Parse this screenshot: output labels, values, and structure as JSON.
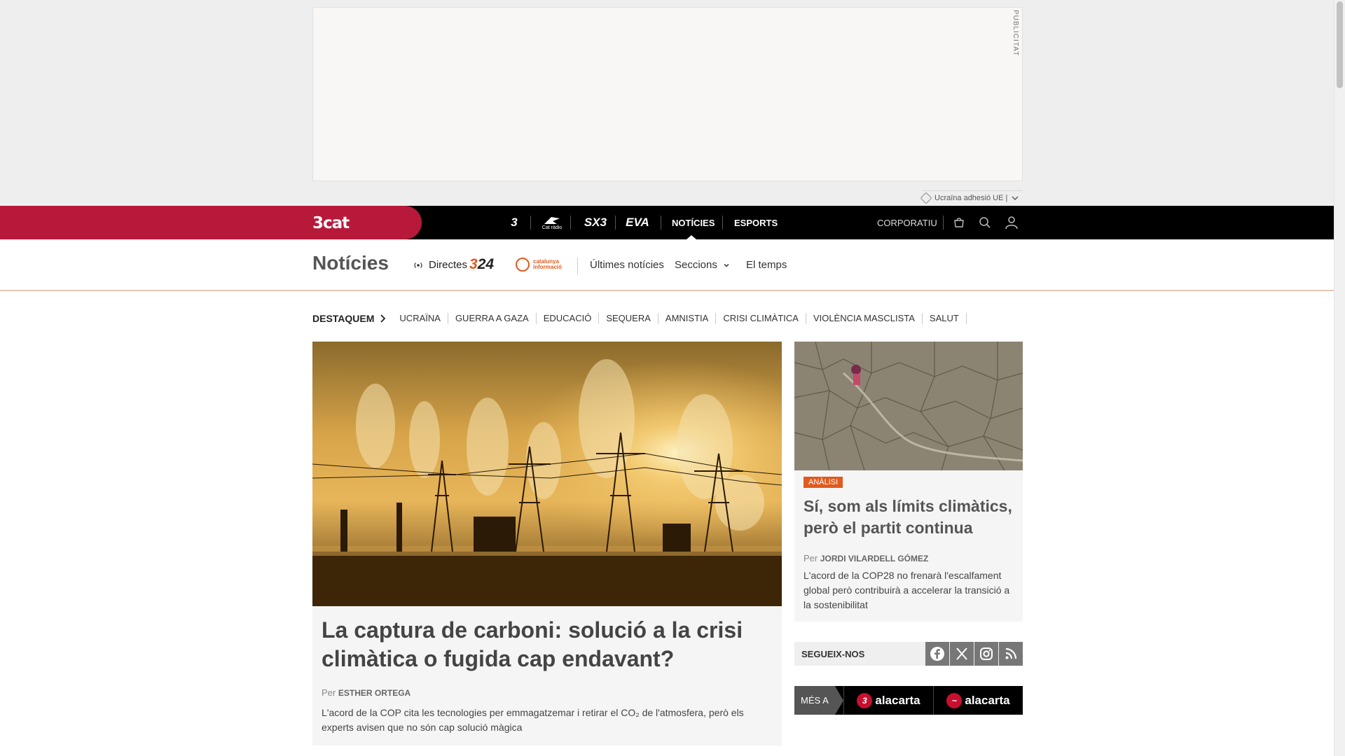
{
  "ad": {
    "label": "PUBLICITAT",
    "tag_text": "Ucraïna adhesió UE |"
  },
  "topnav": {
    "logo": "3cat",
    "channels": [
      "3",
      "Cat ràdio",
      "SX3",
      "EVA"
    ],
    "links": [
      "NOTÍCIES",
      "ESPORTS"
    ],
    "corporate": "CORPORATIU"
  },
  "section": {
    "title": "Notícies",
    "directes": "Directes",
    "logo_324": "324",
    "catinfo_text": "catalunya informació",
    "links": [
      "Últimes notícies",
      "Seccions",
      "El temps"
    ]
  },
  "topics": {
    "label": "DESTAQUEM",
    "items": [
      "UCRAÏNA",
      "GUERRA A GAZA",
      "EDUCACIÓ",
      "SEQUERA",
      "AMNISTIA",
      "CRISI CLIMÀTICA",
      "VIOLÈNCIA MASCLISTA",
      "SALUT"
    ]
  },
  "main_article": {
    "title": "La captura de carboni: solució a la crisi climàtica o fugida cap endavant?",
    "by": "Per",
    "author": "ESTHER ORTEGA",
    "description": "L'acord de la COP cita les tecnologies per emmagatzemar i retirar el CO₂ de l'atmosfera, però els experts avisen que no són cap solució màgica"
  },
  "side_article": {
    "badge": "ANÀLISI",
    "title": "Sí, som als límits climàtics, però el partit continua",
    "by": "Per",
    "author": "JORDI VILARDELL GÓMEZ",
    "description": "L'acord de la COP28 no frenarà l'escalfament global però contribuirà a accelerar la transició a la sostenibilitat"
  },
  "follow": {
    "label": "SEGUEIX-NOS",
    "networks": [
      "facebook-icon",
      "x-icon",
      "instagram-icon",
      "rss-icon"
    ]
  },
  "mesa": {
    "label": "MÉS A",
    "items": [
      "alacarta",
      "alacarta"
    ]
  },
  "colors": {
    "brand_red": "#b8193a",
    "accent_orange": "#e15a1e",
    "nav_black": "#000000"
  }
}
